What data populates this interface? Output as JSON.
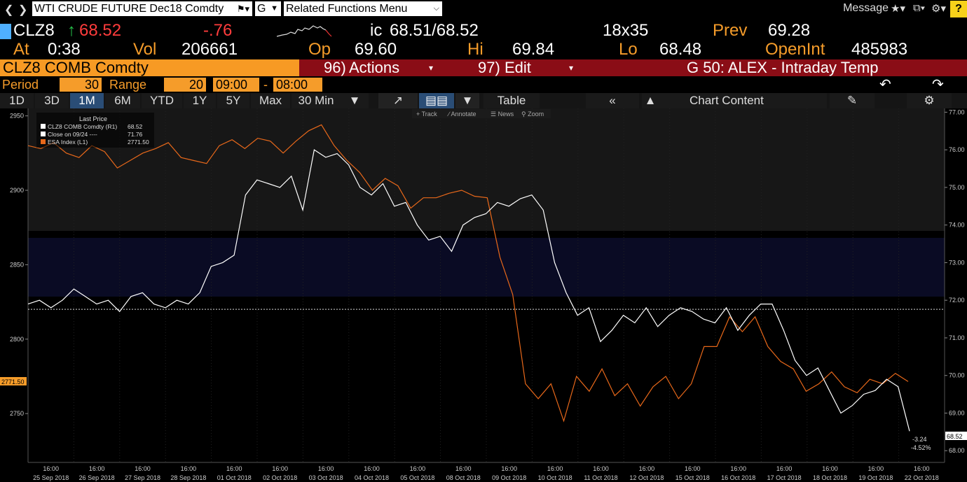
{
  "toolbar": {
    "security": "WTI CRUDE FUTURE Dec18 Comdty",
    "g_label": "G",
    "functions_menu": "Related Functions Menu",
    "message": "Message",
    "help": "?"
  },
  "quote": {
    "ticker": "CLZ8",
    "last": "68.52",
    "change": "-.76",
    "ic_label": "ic",
    "bid_ask": "68.51/68.52",
    "size": "18x35",
    "prev_label": "Prev",
    "prev": "69.28",
    "at_label": "At",
    "time": "0:38",
    "vol_label": "Vol",
    "vol": "206661",
    "op_label": "Op",
    "op": "69.60",
    "hi_label": "Hi",
    "hi": "69.84",
    "lo_label": "Lo",
    "lo": "68.48",
    "oi_label": "OpenInt",
    "oi": "485983"
  },
  "actionbar": {
    "security": "CLZ8 COMB Comdty",
    "actions_num": "96)",
    "actions": "Actions",
    "edit_num": "97)",
    "edit": "Edit",
    "template": "G 50: ALEX - Intraday Temp"
  },
  "period": {
    "period_label": "Period",
    "period_value": "30",
    "range_label": "Range",
    "range_value": "20",
    "from": "09:00",
    "dash": "-",
    "to": "08:00"
  },
  "tabs": {
    "d1": "1D",
    "d3": "3D",
    "m1": "1M",
    "m6": "6M",
    "ytd": "YTD",
    "y1": "1Y",
    "y5": "5Y",
    "max": "Max",
    "interval": "30 Min",
    "table": "Table",
    "chart_content": "Chart Content"
  },
  "chart_tools": {
    "track": "Track",
    "annotate": "Annotate",
    "news": "News",
    "zoom": "Zoom"
  },
  "colors": {
    "orange": "#f59c2a",
    "darkred": "#8a0d16",
    "tab_selected": "#2a4d76",
    "esa_line": "#e8681a",
    "clz8_line": "#ffffff"
  },
  "chart_data": {
    "type": "line",
    "legend": {
      "title": "Last Price",
      "items": [
        {
          "name": "CLZ8 COMB Comdty (R1)",
          "value": "68.52",
          "color": "#ffffff"
        },
        {
          "name": "Close on 09/24 ----",
          "value": "71.76",
          "color": "#ffffff"
        },
        {
          "name": "ESA Index (L1)",
          "value": "2771.50",
          "color": "#e8681a"
        }
      ]
    },
    "dates": [
      "25 Sep 2018",
      "26 Sep 2018",
      "27 Sep 2018",
      "28 Sep 2018",
      "01 Oct 2018",
      "02 Oct 2018",
      "03 Oct 2018",
      "04 Oct 2018",
      "05 Oct 2018",
      "08 Oct 2018",
      "09 Oct 2018",
      "10 Oct 2018",
      "11 Oct 2018",
      "12 Oct 2018",
      "15 Oct 2018",
      "16 Oct 2018",
      "17 Oct 2018",
      "18 Oct 2018",
      "19 Oct 2018",
      "22 Oct 2018"
    ],
    "time_label": "16:00",
    "left_axis": {
      "ticks": [
        "2950",
        "2900",
        "2850",
        "2800",
        "2750"
      ],
      "range": [
        2720,
        2955
      ]
    },
    "right_axis": {
      "ticks": [
        "77.00",
        "76.00",
        "75.00",
        "74.00",
        "73.00",
        "72.00",
        "71.00",
        "70.00",
        "69.00",
        "68.00"
      ],
      "range": [
        67.8,
        77.1
      ]
    },
    "series": [
      {
        "name": "CLZ8 COMB Comdty (R1)",
        "axis": "right",
        "values": [
          71.9,
          72.0,
          71.8,
          72.0,
          72.3,
          72.1,
          71.9,
          72.0,
          71.7,
          72.1,
          72.2,
          71.9,
          71.8,
          72.0,
          71.9,
          72.2,
          72.9,
          73.0,
          73.2,
          74.8,
          75.2,
          75.1,
          75.0,
          75.3,
          74.4,
          76.0,
          75.8,
          75.9,
          75.6,
          75.0,
          74.8,
          75.1,
          74.5,
          74.6,
          74.0,
          73.6,
          73.7,
          73.3,
          74.0,
          74.2,
          74.3,
          74.6,
          74.5,
          74.7,
          74.8,
          74.4,
          73.0,
          72.2,
          71.6,
          71.8,
          70.9,
          71.2,
          71.6,
          71.4,
          71.8,
          71.3,
          71.6,
          71.8,
          71.7,
          71.5,
          71.4,
          71.8,
          71.2,
          71.6,
          71.9,
          71.9,
          71.2,
          70.4,
          70.0,
          70.2,
          69.6,
          69.0,
          69.2,
          69.5,
          69.6,
          69.9,
          69.7,
          68.52
        ]
      },
      {
        "name": "ESA Index (L1)",
        "axis": "left",
        "values": [
          2930,
          2928,
          2932,
          2925,
          2922,
          2930,
          2926,
          2915,
          2920,
          2925,
          2928,
          2932,
          2922,
          2920,
          2918,
          2930,
          2934,
          2928,
          2935,
          2933,
          2925,
          2933,
          2940,
          2944,
          2930,
          2920,
          2912,
          2900,
          2908,
          2903,
          2888,
          2895,
          2895,
          2898,
          2900,
          2896,
          2895,
          2855,
          2830,
          2770,
          2760,
          2770,
          2745,
          2775,
          2765,
          2780,
          2762,
          2770,
          2755,
          2768,
          2775,
          2760,
          2770,
          2795,
          2795,
          2815,
          2805,
          2815,
          2795,
          2785,
          2780,
          2765,
          2770,
          2778,
          2768,
          2764,
          2773,
          2770,
          2777,
          2771.5
        ]
      }
    ],
    "close_line": 71.76,
    "last_value_label": "68.52",
    "esa_value_label": "2771.50",
    "change_label": "-3.24",
    "change_pct_label": "-4.52%"
  }
}
